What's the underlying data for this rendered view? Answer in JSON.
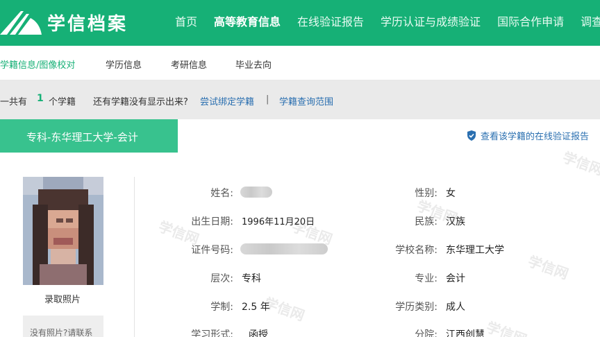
{
  "header": {
    "logo_text": "学信档案",
    "nav": [
      {
        "label": "首页"
      },
      {
        "label": "高等教育信息"
      },
      {
        "label": "在线验证报告"
      },
      {
        "label": "学历认证与成绩验证"
      },
      {
        "label": "国际合作申请"
      },
      {
        "label": "调查/投"
      }
    ],
    "active_index": 1,
    "colors": {
      "brand": "#16b076",
      "accent": "#38c28e",
      "link": "#2a6fb0"
    }
  },
  "subnav": {
    "items": [
      "学籍信息/图像校对",
      "学历信息",
      "考研信息",
      "毕业去向"
    ]
  },
  "infobar": {
    "prefix": "一共有",
    "count": "1",
    "suffix": "个学籍",
    "question": "还有学籍没有显示出来?",
    "bind_link": "尝试绑定学籍",
    "separator": "|",
    "scope_link": "学籍查询范围"
  },
  "record": {
    "tab_title": "专科-东华理工大学-会计",
    "verify_link": "查看该学籍的在线验证报告",
    "watermark": "学信网"
  },
  "photo": {
    "label": "录取照片",
    "no_photo_text": "没有照片?请联系"
  },
  "fields": {
    "name_label": "姓名:",
    "gender_label": "性别:",
    "gender_value": "女",
    "birth_label": "出生日期:",
    "birth_value": "1996年11月20日",
    "ethnicity_label": "民族:",
    "ethnicity_value": "汉族",
    "id_label": "证件号码:",
    "school_label": "学校名称:",
    "school_value": "东华理工大学",
    "level_label": "层次:",
    "level_value": "专科",
    "major_label": "专业:",
    "major_value": "会计",
    "duration_label": "学制:",
    "duration_value": "2.5 年",
    "category_label": "学历类别:",
    "category_value": "成人",
    "form_label": "学习形式:",
    "form_value": "函授",
    "branch_label": "分院:",
    "branch_value": "江西创慧"
  }
}
